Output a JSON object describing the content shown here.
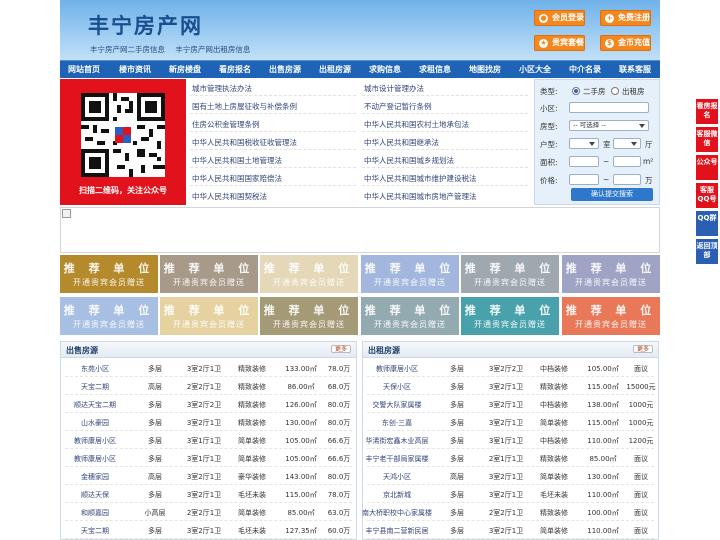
{
  "header": {
    "logo": "丰宁房产网",
    "sublinks": [
      "丰宁房产网二手房信息",
      "丰宁房产网出租房信息"
    ],
    "buttons": [
      {
        "label": "会员登录",
        "icon": "user-icon"
      },
      {
        "label": "免费注册",
        "icon": "add-user-icon"
      },
      {
        "label": "贵宾套餐",
        "icon": "vip-icon"
      },
      {
        "label": "金币充值",
        "icon": "coin-icon"
      }
    ]
  },
  "nav": {
    "items": [
      "网站首页",
      "楼市资讯",
      "新房楼盘",
      "看房报名",
      "出售房源",
      "出租房源",
      "求购信息",
      "求租信息",
      "地图找房",
      "小区大全",
      "中介名录",
      "联系客服"
    ]
  },
  "qr": {
    "caption": "扫描二维码，关注公众号"
  },
  "links": {
    "left": [
      "城市管理执法办法",
      "国有土地上房屋征收与补偿条例",
      "住房公积金管理条例",
      "中华人民共和国税收征收管理法",
      "中华人民共和国土地管理法",
      "中华人民共和国国家赔偿法",
      "中华人民共和国契税法"
    ],
    "right": [
      "城市设计管理办法",
      "不动产登记暂行条例",
      "中华人民共和国农村土地承包法",
      "中华人民共和国继承法",
      "中华人民共和国城乡规划法",
      "中华人民共和国城市维护建设税法",
      "中华人民共和国城市房地产管理法"
    ]
  },
  "search": {
    "type_label": "类型:",
    "type_options": [
      "二手房",
      "出租房"
    ],
    "community_label": "小区:",
    "housing_label": "房型:",
    "housing_value": "-- 可选择 --",
    "layout_label": "户型:",
    "room_unit": "室",
    "hall_unit": "厅",
    "area_label": "面积:",
    "area_unit": "m²",
    "price_label": "价格:",
    "price_unit": "万",
    "range_sep": "~",
    "submit": "确认提交搜索"
  },
  "recommend": {
    "title": "推 荐 单 位",
    "subtitle": "开通贵宾会员赠送",
    "colors": [
      "#b58a2c",
      "#a89a88",
      "#e5d8b8",
      "#a3b7de",
      "#9ea8ae",
      "#a0a4c4",
      "#a8bfe4",
      "#e6d2a0",
      "#a49a76",
      "#93aab0",
      "#49a2ab",
      "#e87858"
    ]
  },
  "sale": {
    "title": "出售房源",
    "more": "更多",
    "rows": [
      [
        "东苑小区",
        "多层",
        "3室2厅1卫",
        "精致装修",
        "133.00㎡",
        "78.0万"
      ],
      [
        "天宝二期",
        "高层",
        "2室2厅1卫",
        "精致装修",
        "86.00㎡",
        "68.0万"
      ],
      [
        "顺达天宝二期",
        "多层",
        "3室2厅2卫",
        "精致装修",
        "126.00㎡",
        "80.0万"
      ],
      [
        "山水豪园",
        "多层",
        "3室2厅1卫",
        "精致装修",
        "130.00㎡",
        "80.0万"
      ],
      [
        "教师康居小区",
        "多层",
        "3室1厅1卫",
        "简单装修",
        "105.00㎡",
        "66.6万"
      ],
      [
        "教师康居小区",
        "多层",
        "3室1厅1卫",
        "简单装修",
        "105.00㎡",
        "66.6万"
      ],
      [
        "金穗家园",
        "高层",
        "3室2厅1卫",
        "豪华装修",
        "143.00㎡",
        "80.0万"
      ],
      [
        "顺达天保",
        "多层",
        "3室2厅1卫",
        "毛坯未装",
        "115.00㎡",
        "78.0万"
      ],
      [
        "和顺嘉园",
        "小高层",
        "2室2厅1卫",
        "简单装修",
        "85.00㎡",
        "63.0万"
      ],
      [
        "天宝二期",
        "多层",
        "3室2厅1卫",
        "毛坯未装",
        "127.35㎡",
        "60.0万"
      ]
    ]
  },
  "rent": {
    "title": "出租房源",
    "more": "更多",
    "rows": [
      [
        "教师康居小区",
        "多层",
        "3室2厅2卫",
        "中档装修",
        "105.00㎡",
        "面议"
      ],
      [
        "天保小区",
        "多层",
        "3室2厅1卫",
        "精致装修",
        "115.00㎡",
        "15000元"
      ],
      [
        "交警大队家属楼",
        "多层",
        "3室2厅1卫",
        "中档装修",
        "138.00㎡",
        "1000元"
      ],
      [
        "东创·三嘉",
        "多层",
        "3室2厅1卫",
        "简单装修",
        "115.00㎡",
        "1000元"
      ],
      [
        "华浠街宏鑫木业高层",
        "多层",
        "3室1厅1卫",
        "中档装修",
        "110.00㎡",
        "1200元"
      ],
      [
        "丰宁老干部局家属楼",
        "多层",
        "2室1厅1卫",
        "精致装修",
        "85.00㎡",
        "面议"
      ],
      [
        "天鸿小区",
        "高层",
        "3室2厅1卫",
        "简单装修",
        "130.00㎡",
        "面议"
      ],
      [
        "京北新城",
        "多层",
        "3室2厅1卫",
        "毛坯未装",
        "110.00㎡",
        "面议"
      ],
      [
        "南大桥职校中心家属楼",
        "多层",
        "2室2厅1卫",
        "精致装修",
        "100.00㎡",
        "面议"
      ],
      [
        "丰宁县南二营新民居",
        "多层",
        "3室2厅1卫",
        "简单装修",
        "110.00㎡",
        "面议"
      ]
    ]
  },
  "float": [
    "看房报名",
    "客服微信",
    "公众号",
    "客服QQ号",
    "QQ群",
    "返回顶部"
  ]
}
